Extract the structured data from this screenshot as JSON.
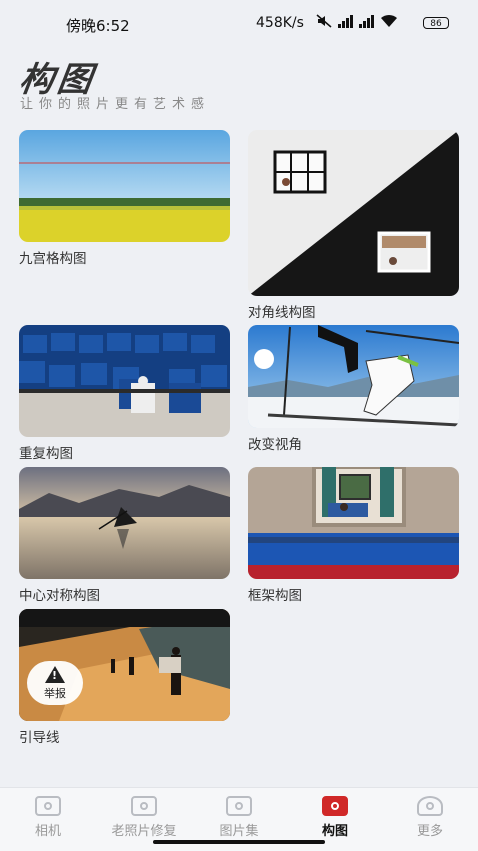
{
  "status_bar": {
    "time": "傍晚6:52",
    "speed": "458K/s",
    "battery": "86"
  },
  "header": {
    "title": "构图",
    "subtitle": "让你的照片更有艺术感"
  },
  "cards": [
    {
      "label": "九宫格构图"
    },
    {
      "label": "对角线构图"
    },
    {
      "label": "重复构图"
    },
    {
      "label": "改变视角"
    },
    {
      "label": "中心对称构图"
    },
    {
      "label": "框架构图"
    },
    {
      "label": "引导线"
    }
  ],
  "report_button": "举报",
  "nav": {
    "items": [
      {
        "label": "相机",
        "icon": "camera-icon"
      },
      {
        "label": "老照片修复",
        "icon": "photo-restore-icon"
      },
      {
        "label": "图片集",
        "icon": "gallery-icon"
      },
      {
        "label": "构图",
        "icon": "composition-icon",
        "active": true
      },
      {
        "label": "更多",
        "icon": "user-icon"
      }
    ],
    "active_color": "#d02828"
  }
}
